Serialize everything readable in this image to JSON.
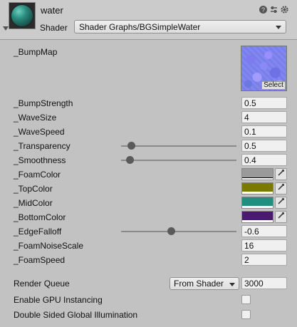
{
  "header": {
    "material_name": "water",
    "shader_label": "Shader",
    "shader_value": "Shader Graphs/BGSimpleWater",
    "icons": [
      "help-icon",
      "preset-icon",
      "settings-icon"
    ]
  },
  "properties": {
    "bumpmap": {
      "label": "_BumpMap",
      "select_label": "Select"
    },
    "bump_strength": {
      "label": "_BumpStrength",
      "value": "0.5"
    },
    "wave_size": {
      "label": "_WaveSize",
      "value": "4"
    },
    "wave_speed": {
      "label": "_WaveSpeed",
      "value": "0.1"
    },
    "transparency": {
      "label": "_Transparency",
      "value": "0.5",
      "slider_fraction": 0.05
    },
    "smoothness": {
      "label": "_Smoothness",
      "value": "0.4",
      "slider_fraction": 0.04
    },
    "foam_color": {
      "label": "_FoamColor",
      "color": "#9a9a9a"
    },
    "top_color": {
      "label": "_TopColor",
      "color": "#7a7a00"
    },
    "mid_color": {
      "label": "_MidColor",
      "color": "#1f8f7f"
    },
    "bottom_color": {
      "label": "_BottomColor",
      "color": "#4a1a6e"
    },
    "edge_falloff": {
      "label": "_EdgeFalloff",
      "value": "-0.6",
      "slider_fraction": 0.4
    },
    "foam_noise_scale": {
      "label": "_FoamNoiseScale",
      "value": "16"
    },
    "foam_speed": {
      "label": "_FoamSpeed",
      "value": "2"
    }
  },
  "footer": {
    "render_queue": {
      "label": "Render Queue",
      "mode": "From Shader",
      "value": "3000"
    },
    "gpu_instancing": {
      "label": "Enable GPU Instancing",
      "checked": false
    },
    "double_sided_gi": {
      "label": "Double Sided Global Illumination",
      "checked": false
    }
  }
}
